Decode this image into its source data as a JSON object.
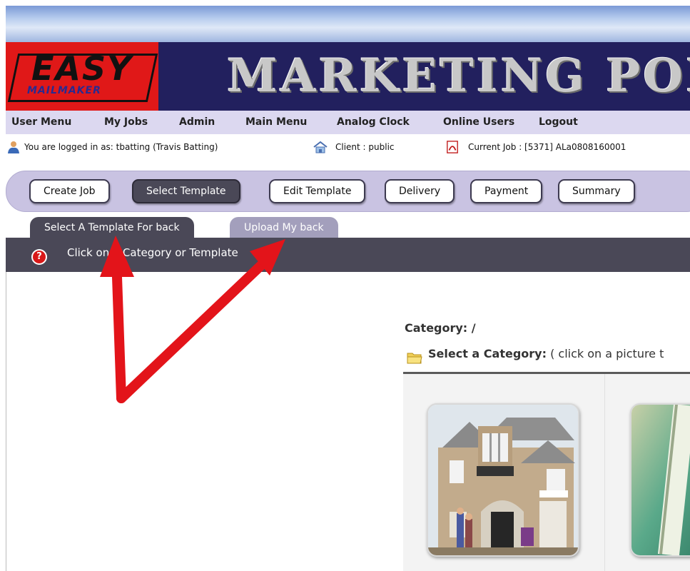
{
  "header": {
    "logo_top": "EASY",
    "logo_bottom": "MAILMAKER",
    "title": "MARKETING POR"
  },
  "menu": {
    "items": [
      "User Menu",
      "My Jobs",
      "Admin",
      "Main Menu",
      "Analog Clock",
      "Online Users",
      "Logout"
    ]
  },
  "info": {
    "logged_in": "You are logged in as: tbatting (Travis Batting)",
    "client": "Client :  public",
    "current_job": "Current Job : [5371] ALa0808160001"
  },
  "steps": {
    "items": [
      "Create Job",
      "Select Template",
      "Edit Template",
      "Delivery",
      "Payment",
      "Summary"
    ],
    "active": "Select Template"
  },
  "tabs": {
    "items": [
      "Select A Template For back",
      "Upload My back"
    ],
    "active": "Select A Template For back"
  },
  "instruction": "Click on a Category or Template",
  "category": {
    "label": "Category: /",
    "select_bold": "Select a Category:",
    "select_rest": " ( click on a picture t"
  },
  "colors": {
    "banner": "#22205e",
    "logo_red": "#e01818",
    "menu_bg": "#dcd8f0",
    "step_bar": "#c9c3e2",
    "dark_tab": "#4a4857",
    "arrow_red": "#e3141a"
  },
  "icons": [
    "user-icon",
    "home-icon",
    "pdf-icon",
    "help-icon",
    "folder-icon"
  ]
}
